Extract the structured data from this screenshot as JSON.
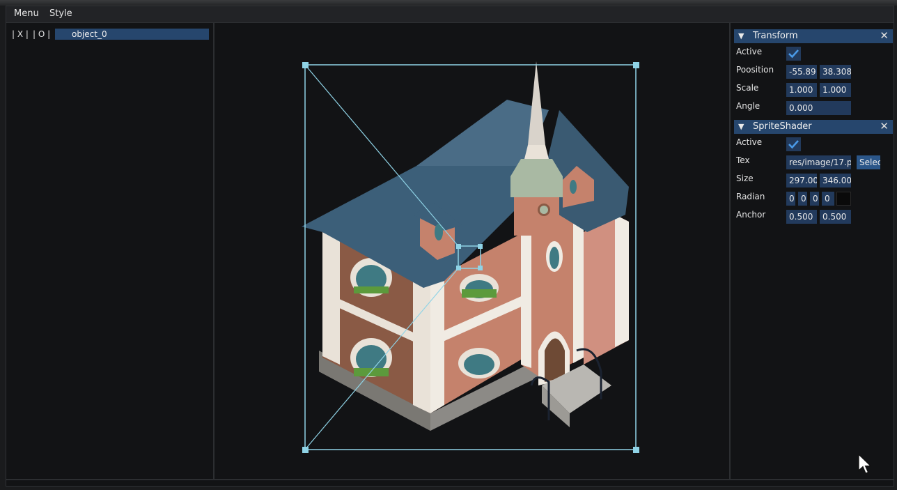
{
  "menubar": {
    "items": [
      "Menu",
      "Style"
    ]
  },
  "hierarchy": {
    "toggle_x": "| X |",
    "toggle_o": "| O |",
    "objects": [
      "object_0"
    ]
  },
  "inspector": {
    "transform": {
      "title": "Transform",
      "active_label": "Active",
      "active": true,
      "position_label": "Poosition",
      "position": [
        "-55.89",
        "38.308"
      ],
      "scale_label": "Scale",
      "scale": [
        "1.000",
        "1.000"
      ],
      "angle_label": "Angle",
      "angle": "0.000"
    },
    "sprite_shader": {
      "title": "SpriteShader",
      "active_label": "Active",
      "active": true,
      "tex_label": "Tex",
      "tex": "res/image/17.p",
      "select_label": "Selec",
      "size_label": "Size",
      "size": [
        "297.00",
        "346.00"
      ],
      "radian_label": "Radian",
      "radian": [
        "0",
        "0",
        "0",
        "0"
      ],
      "radian_color": "#0a0a0a",
      "anchor_label": "Anchor",
      "anchor": [
        "0.500",
        "0.500"
      ]
    }
  },
  "icons": {
    "collapse": "triangle-down-icon",
    "close": "close-icon",
    "check": "checkmark-icon",
    "cursor": "mouse-pointer-icon"
  },
  "colors": {
    "header": "#26466d",
    "field": "#223a5c",
    "gizmo": "#8fd3e6",
    "check": "#4a9ae8"
  }
}
